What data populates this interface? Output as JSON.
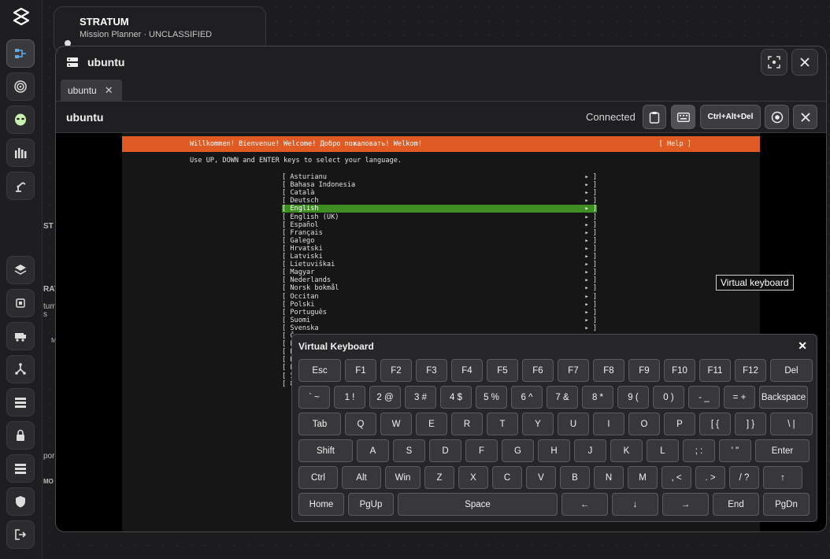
{
  "app": {
    "name": "STRATUM",
    "subtitle": "Mission Planner · UNCLASSIFIED"
  },
  "background_fragments": [
    "ST",
    "RAT",
    "tum",
    "s",
    "M",
    "por",
    "MO"
  ],
  "window": {
    "title": "ubuntu",
    "tab_label": "ubuntu",
    "session_name": "ubuntu",
    "status": "Connected",
    "cad_label": "Ctrl+Alt+Del"
  },
  "terminal": {
    "banner": "Willkommen! Bienvenue! Welcome! Добро пожаловать! Welkom!",
    "help": "[ Help ]",
    "instruction": "Use UP, DOWN and ENTER keys to select your language.",
    "languages": [
      "Asturianu",
      "Bahasa Indonesia",
      "Català",
      "Deutsch",
      "English",
      "English (UK)",
      "Español",
      "Français",
      "Galego",
      "Hrvatski",
      "Latviski",
      "Lietuviškai",
      "Magyar",
      "Nederlands",
      "Norsk bokmål",
      "Occitan",
      "Polski",
      "Português",
      "Suomi",
      "Svenska"
    ],
    "selected": "English",
    "hidden_rows": [
      "Č",
      "Ε",
      "Б",
      "К",
      "Р",
      "У",
      "Ɛ"
    ]
  },
  "tooltip": "Virtual keyboard",
  "keyboard": {
    "title": "Virtual Keyboard",
    "close": "✕",
    "rows": [
      [
        "Esc",
        "F1",
        "F2",
        "F3",
        "F4",
        "F5",
        "F6",
        "F7",
        "F8",
        "F9",
        "F10",
        "F11",
        "F12",
        "Del"
      ],
      [
        "` ~",
        "1 !",
        "2 @",
        "3 #",
        "4 $",
        "5 %",
        "6 ^",
        "7 &",
        "8 *",
        "9 (",
        "0 )",
        "- _",
        "= +",
        "Backspace"
      ],
      [
        "Tab",
        "Q",
        "W",
        "E",
        "R",
        "T",
        "Y",
        "U",
        "I",
        "O",
        "P",
        "[ {",
        "] }",
        "\\ |"
      ],
      [
        "Shift",
        "A",
        "S",
        "D",
        "F",
        "G",
        "H",
        "J",
        "K",
        "L",
        "; :",
        "' \"",
        "Enter"
      ],
      [
        "Ctrl",
        "Alt",
        "Win",
        "Z",
        "X",
        "C",
        "V",
        "B",
        "N",
        "M",
        ", <",
        ". >",
        "/ ?",
        "↑"
      ],
      [
        "Home",
        "PgUp",
        "Space",
        "←",
        "↓",
        "→",
        "End",
        "PgDn"
      ]
    ]
  },
  "icons": {
    "rail": [
      "mission-icon",
      "target-icon",
      "alien-icon",
      "assets-icon",
      "robot-arm-icon",
      "layers-icon",
      "chip-icon",
      "vehicle-icon",
      "network-icon",
      "list-icon",
      "lock-icon",
      "server-icon",
      "shield-icon",
      "logout-icon"
    ],
    "window_head": [
      "server-icon",
      "fullscreen-icon",
      "close-icon"
    ],
    "toolbar": [
      "clipboard-icon",
      "keyboard-icon",
      "record-icon",
      "close-icon"
    ]
  },
  "colors": {
    "banner": "#e05a23",
    "selection": "#3e8e24",
    "background": "#1c1c1e"
  }
}
